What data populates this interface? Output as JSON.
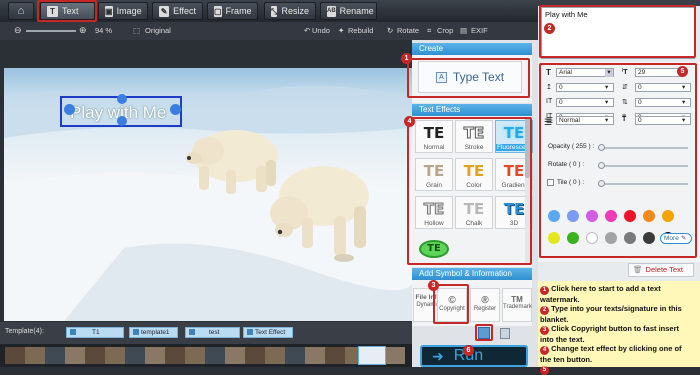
{
  "toolbar": {
    "tabs": [
      "Text",
      "Image",
      "Effect",
      "Frame",
      "Resize",
      "Rename"
    ],
    "active_tab": "Text",
    "home_icon": "home-icon"
  },
  "subbar": {
    "zoom": "94 %",
    "original_label": "Original",
    "undo": "Undo",
    "rebuild": "Rebuild",
    "rotate": "Rotate",
    "crop": "Crop",
    "exif": "EXIF"
  },
  "canvas": {
    "watermark_text": "Play with Me"
  },
  "panel": {
    "create_header": "Create",
    "type_text_button": "Type Text",
    "text_effects_header": "Text Effects",
    "effects": [
      {
        "glyph": "TE",
        "label": "Normal"
      },
      {
        "glyph": "TE",
        "label": "Stroke"
      },
      {
        "glyph": "TE",
        "label": "Fluorescent"
      },
      {
        "glyph": "TE",
        "label": "Grain"
      },
      {
        "glyph": "TE",
        "label": "Color"
      },
      {
        "glyph": "TE",
        "label": "Gradient"
      },
      {
        "glyph": "TE",
        "label": "Hollow"
      },
      {
        "glyph": "TE",
        "label": "Chalk"
      },
      {
        "glyph": "TE",
        "label": "3D"
      },
      {
        "glyph": "TE",
        "label": ""
      }
    ],
    "symbol_header": "Add Symbol & Information",
    "symbols": [
      {
        "glyph": "File Info",
        "label": "Dynamic"
      },
      {
        "glyph": "©",
        "label": "Copyright"
      },
      {
        "glyph": "®",
        "label": "Register"
      },
      {
        "glyph": "TM",
        "label": "Trademark"
      }
    ]
  },
  "text_editor": {
    "value": "Play with Me"
  },
  "props": {
    "font": "Arial",
    "size": "29",
    "field_values": [
      "0",
      "0",
      "0",
      "0",
      "0",
      "0"
    ],
    "style": "Normal",
    "style_value": "0",
    "opacity_label": "Opacity ( 255 ) :",
    "opacity_value": 255,
    "rotate_label": "Rotate ( 0 ) :",
    "rotate_value": 0,
    "tile_label": "Tile ( 0 ) :",
    "tile_value": 0,
    "colors": [
      "#5aa8f0",
      "#7a9bf2",
      "#d35ee6",
      "#f03cb5",
      "#e8142c",
      "#f08a18",
      "#f5a300",
      "#e6e61e",
      "#3ab11e",
      "#ffffff",
      "#a2a2a2",
      "#7a7a7a",
      "#3c3c3c",
      "#111111"
    ],
    "more_button": "More",
    "delete_button": "Delete Text"
  },
  "templates": {
    "label": "Template(4):",
    "items": [
      "T1",
      "template1",
      "test",
      "Text Effect ..."
    ]
  },
  "run_button": "Run",
  "instructions": [
    {
      "num": "1",
      "text": "Click here to start to add a text watermark."
    },
    {
      "num": "2",
      "text": "Type into your texts/signature in this blanket."
    },
    {
      "num": "3",
      "text": "Click Copyright button to fast insert into the text."
    },
    {
      "num": "4",
      "text": "Change text effect by clicking one of the ten button."
    },
    {
      "num": "5",
      "text": ""
    }
  ],
  "badges": [
    "1",
    "2",
    "3",
    "4",
    "5",
    "6"
  ]
}
